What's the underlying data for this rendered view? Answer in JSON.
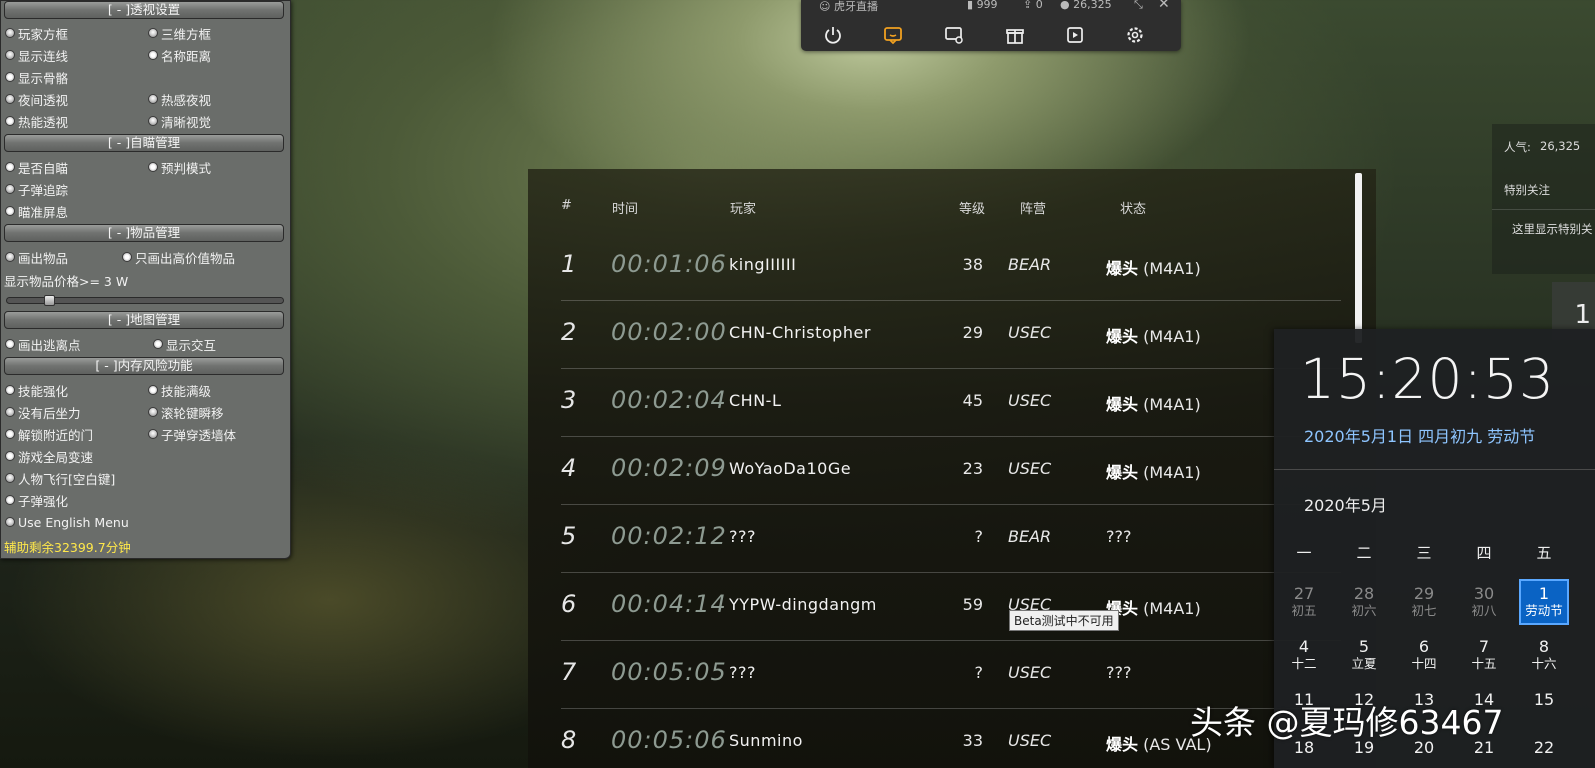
{
  "cheat_menu": {
    "sections": [
      {
        "title": "[ - ]透视设置"
      },
      {
        "title": "[ - ]自瞄管理"
      },
      {
        "title": "[ - ]物品管理"
      },
      {
        "title": "[ - ]地图管理"
      },
      {
        "title": "[ - ]内存风险功能"
      }
    ],
    "esp": {
      "player_box": "玩家方框",
      "box_3d": "三维方框",
      "show_lines": "显示连线",
      "name_distance": "名称距离",
      "show_skeleton": "显示骨骼",
      "night_vision": "夜间透视",
      "thermal_night": "热感夜视",
      "thermal_vision": "热能透视",
      "clear_vision": "清晰视觉"
    },
    "aim": {
      "auto_aim": "是否自瞄",
      "prediction": "预判模式",
      "bullet_track": "子弹追踪",
      "aim_screen": "瞄准屏息"
    },
    "items": {
      "draw_items": "画出物品",
      "high_value_only": "只画出高价值物品",
      "price_label": "显示物品价格>= 3 W",
      "price_value": 3
    },
    "map": {
      "draw_exits": "画出逃离点",
      "show_interact": "显示交互"
    },
    "memory": {
      "skill_boost": "技能强化",
      "skill_max": "技能满级",
      "no_recoil": "没有后坐力",
      "scroll_teleport": "滚轮键瞬移",
      "unlock_doors": "解锁附近的门",
      "bullet_penetrate": "子弹穿透墙体",
      "game_speed": "游戏全局变速",
      "fly": "人物飞行[空白键]",
      "bullet_boost": "子弹强化",
      "english_menu": "Use English Menu"
    },
    "remaining": "辅助剩余32399.7分钟"
  },
  "stream_bar": {
    "brand": "虎牙直播",
    "stat1": "999",
    "stat2": "0",
    "viewers": "26,325"
  },
  "scoreboard": {
    "headers": {
      "rank": "#",
      "time": "时间",
      "player": "玩家",
      "level": "等级",
      "faction": "阵营",
      "status": "状态"
    },
    "rows": [
      {
        "rank": "1",
        "time": "00:01:06",
        "player": "kingIIIIII",
        "level": "38",
        "faction": "BEAR",
        "status_bold": "爆头",
        "status_rest": " (M4A1)"
      },
      {
        "rank": "2",
        "time": "00:02:00",
        "player": "CHN-Christopher",
        "level": "29",
        "faction": "USEC",
        "status_bold": "爆头",
        "status_rest": " (M4A1)"
      },
      {
        "rank": "3",
        "time": "00:02:04",
        "player": "CHN-L",
        "level": "45",
        "faction": "USEC",
        "status_bold": "爆头",
        "status_rest": " (M4A1)"
      },
      {
        "rank": "4",
        "time": "00:02:09",
        "player": "WoYaoDa10Ge",
        "level": "23",
        "faction": "USEC",
        "status_bold": "爆头",
        "status_rest": " (M4A1)"
      },
      {
        "rank": "5",
        "time": "00:02:12",
        "player": "???",
        "level": "?",
        "faction": "BEAR",
        "status_bold": "",
        "status_rest": "???"
      },
      {
        "rank": "6",
        "time": "00:04:14",
        "player": "YYPW-dingdangm",
        "level": "59",
        "faction": "USEC",
        "status_bold": "爆头",
        "status_rest": " (M4A1)"
      },
      {
        "rank": "7",
        "time": "00:05:05",
        "player": "???",
        "level": "?",
        "faction": "USEC",
        "status_bold": "",
        "status_rest": "???"
      },
      {
        "rank": "8",
        "time": "00:05:06",
        "player": "Sunmino",
        "level": "33",
        "faction": "USEC",
        "status_bold": "爆头",
        "status_rest": " (AS VAL)"
      }
    ],
    "tooltip": "Beta测试中不可用"
  },
  "side_panel": {
    "popularity_label": "人气:",
    "popularity_value": "26,325",
    "special_follow": "特别关注",
    "special_hint": "这里显示特别关",
    "number": "1"
  },
  "clock": {
    "time": "15:20:53",
    "date": "2020年5月1日 四月初九 劳动节",
    "month": "2020年5月",
    "weekdays": [
      "一",
      "二",
      "三",
      "四",
      "五"
    ],
    "weeks": [
      [
        {
          "n": "27",
          "l": "初五",
          "dim": true
        },
        {
          "n": "28",
          "l": "初六",
          "dim": true
        },
        {
          "n": "29",
          "l": "初七",
          "dim": true
        },
        {
          "n": "30",
          "l": "初八",
          "dim": true
        },
        {
          "n": "1",
          "l": "劳动节",
          "today": true
        }
      ],
      [
        {
          "n": "4",
          "l": "十二"
        },
        {
          "n": "5",
          "l": "立夏"
        },
        {
          "n": "6",
          "l": "十四"
        },
        {
          "n": "7",
          "l": "十五"
        },
        {
          "n": "8",
          "l": "十六"
        }
      ],
      [
        {
          "n": "11",
          "l": ""
        },
        {
          "n": "12",
          "l": ""
        },
        {
          "n": "13",
          "l": ""
        },
        {
          "n": "14",
          "l": ""
        },
        {
          "n": "15",
          "l": ""
        }
      ],
      [
        {
          "n": "18",
          "l": ""
        },
        {
          "n": "19",
          "l": ""
        },
        {
          "n": "20",
          "l": ""
        },
        {
          "n": "21",
          "l": ""
        },
        {
          "n": "22",
          "l": ""
        }
      ]
    ]
  },
  "watermark": "头条 @夏玛修63467"
}
